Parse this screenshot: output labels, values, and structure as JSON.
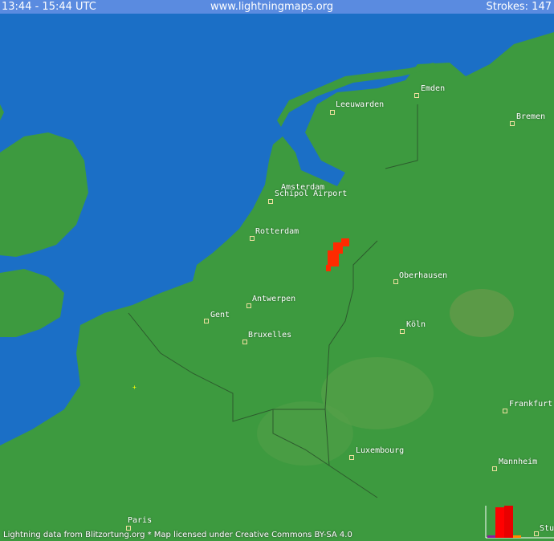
{
  "header": {
    "time_range": "13:44 - 15:44 UTC",
    "site": "www.lightningmaps.org",
    "strokes": "Strokes: 147"
  },
  "cities": [
    {
      "name": "Emden"
    },
    {
      "name": "Leeuwarden"
    },
    {
      "name": "Bremen"
    },
    {
      "name": "Amsterdam"
    },
    {
      "name": "Schipol Airport"
    },
    {
      "name": "Rotterdam"
    },
    {
      "name": "Oberhausen"
    },
    {
      "name": "Antwerpen"
    },
    {
      "name": "Gent"
    },
    {
      "name": "Bruxelles"
    },
    {
      "name": "Köln"
    },
    {
      "name": "Frankfurt"
    },
    {
      "name": "Luxembourg"
    },
    {
      "name": "Mannheim"
    },
    {
      "name": "Paris"
    },
    {
      "name": "Stuttgart"
    }
  ],
  "footer": "Lightning data from Blitzortung.org  *  Map licensed under Creative Commons BY-SA 4.0",
  "colors": {
    "sea": "#1b6fc6",
    "land": "#3d9a3f",
    "strike": "#ff2a00",
    "header": "#5a8be0"
  }
}
